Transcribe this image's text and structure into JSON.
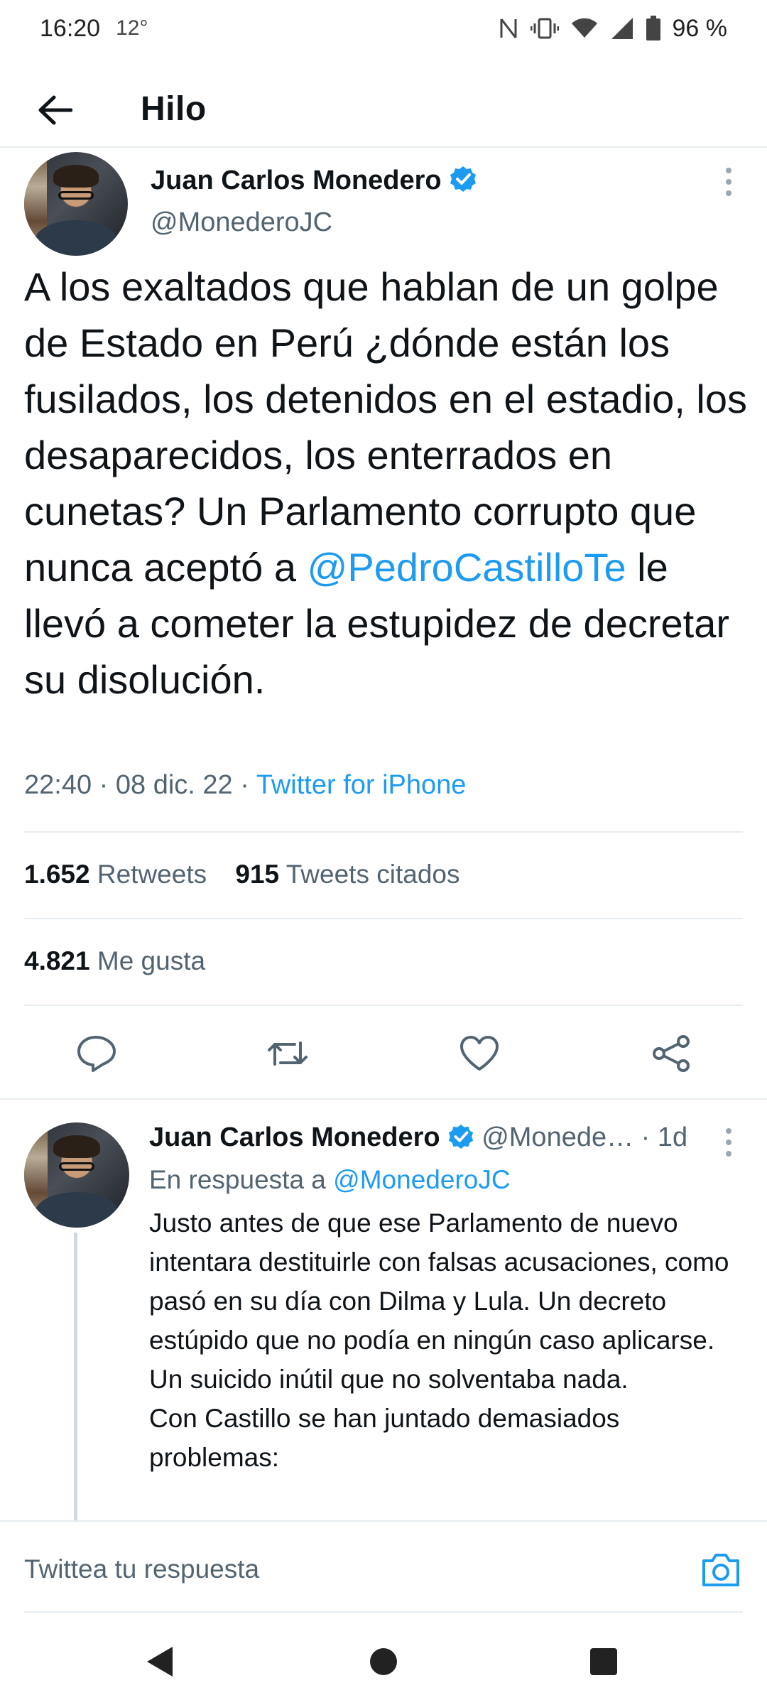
{
  "status_bar": {
    "time": "16:20",
    "temperature": "12°",
    "battery": "96 %"
  },
  "app_bar": {
    "title": "Hilo",
    "back_icon": "arrow-left-icon"
  },
  "main_tweet": {
    "author_name": "Juan Carlos Monedero",
    "handle": "@MonederoJC",
    "text_part1": "A los exaltados que hablan de un golpe de Estado en Perú ¿dónde están los fusilados, los detenidos en el estadio, los desaparecidos, los enterrados en cunetas? Un Parlamento corrupto que nunca aceptó a ",
    "mention": "@PedroCastilloTe",
    "text_part2": " le llevó a cometer la estupidez de decretar su disolución.",
    "timestamp": "22:40 · 08 dic. 22 · ",
    "source": "Twitter for iPhone",
    "retweets_count": "1.652",
    "retweets_label": "Retweets",
    "quotes_count": "915",
    "quotes_label": "Tweets citados",
    "likes_count": "4.821",
    "likes_label": "Me gusta"
  },
  "actions": [
    "reply-icon",
    "retweet-icon",
    "like-icon",
    "share-icon"
  ],
  "reply_tweet": {
    "author_name": "Juan Carlos Monedero",
    "handle": "@Monede…",
    "separator": "·",
    "time": "1d",
    "in_reply_prefix": "En respuesta a ",
    "in_reply_mention": "@MonederoJC",
    "text": "Justo antes de que ese Parlamento de nuevo intentara destituirle con falsas acusaciones, como pasó en su día con Dilma y Lula. Un decreto estúpido que no podía en ningún caso aplicarse. Un suicido inútil que no solventaba nada.\nCon Castillo se han juntado demasiados problemas:"
  },
  "composer": {
    "placeholder": "Twittea tu respuesta"
  },
  "colors": {
    "accent": "#1d9bf0",
    "text": "#0f1419",
    "secondary": "#536471"
  }
}
